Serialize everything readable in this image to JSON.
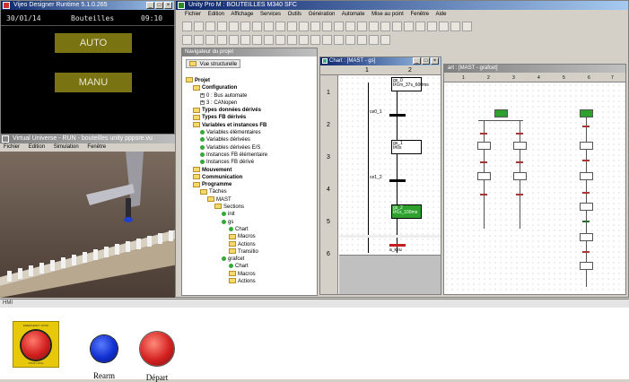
{
  "vijeo": {
    "title": "Vijeo Designer Runtime 5.1.0.265",
    "date": "30/01/14",
    "screen_name": "Bouteilles",
    "time": "09:10",
    "auto_button": "AUTO",
    "manu_button": "MANU"
  },
  "unity": {
    "title": "Unity Pro M : BOUTEILLES M340 SFC",
    "menu": [
      "Fichier",
      "Edition",
      "Affichage",
      "Services",
      "Outils",
      "Génération",
      "Automate",
      "Mise au point",
      "Fenêtre",
      "Aide"
    ]
  },
  "desktop_fragments": [
    "Ad",
    "Do"
  ],
  "navigator": {
    "title": "Navigateur du projet",
    "view_label": "Vue structurelle",
    "tree": [
      {
        "label": "Projet",
        "indent": 0,
        "bold": true,
        "kind": "fold"
      },
      {
        "label": "Configuration",
        "indent": 1,
        "bold": true,
        "kind": "fold"
      },
      {
        "label": "0 : Bus automate",
        "indent": 2,
        "bold": false,
        "kind": "plus"
      },
      {
        "label": "3 : CANopen",
        "indent": 2,
        "bold": false,
        "kind": "plus"
      },
      {
        "label": "Types données dérivés",
        "indent": 1,
        "bold": true,
        "kind": "fold"
      },
      {
        "label": "Types FB dérivés",
        "indent": 1,
        "bold": true,
        "kind": "fold"
      },
      {
        "label": "Variables et instances FB",
        "indent": 1,
        "bold": true,
        "kind": "fold"
      },
      {
        "label": "Variables élémentaires",
        "indent": 2,
        "bold": false,
        "kind": "leaf"
      },
      {
        "label": "Variables dérivées",
        "indent": 2,
        "bold": false,
        "kind": "leaf"
      },
      {
        "label": "Variables dérivées E/S",
        "indent": 2,
        "bold": false,
        "kind": "leaf"
      },
      {
        "label": "Instances FB élémentaire",
        "indent": 2,
        "bold": false,
        "kind": "leaf"
      },
      {
        "label": "Instances FB dérivé",
        "indent": 2,
        "bold": false,
        "kind": "leaf"
      },
      {
        "label": "Mouvement",
        "indent": 1,
        "bold": true,
        "kind": "fold"
      },
      {
        "label": "Communication",
        "indent": 1,
        "bold": true,
        "kind": "fold"
      },
      {
        "label": "Programme",
        "indent": 1,
        "bold": true,
        "kind": "fold"
      },
      {
        "label": "Tâches",
        "indent": 2,
        "bold": false,
        "kind": "fold"
      },
      {
        "label": "MAST",
        "indent": 3,
        "bold": false,
        "kind": "fold"
      },
      {
        "label": "Sections",
        "indent": 4,
        "bold": false,
        "kind": "fold"
      },
      {
        "label": "init",
        "indent": 5,
        "bold": false,
        "kind": "leaf"
      },
      {
        "label": "gs",
        "indent": 5,
        "bold": false,
        "kind": "leaf"
      },
      {
        "label": "Chart",
        "indent": 6,
        "bold": false,
        "kind": "leaf"
      },
      {
        "label": "Macros",
        "indent": 6,
        "bold": false,
        "kind": "fold"
      },
      {
        "label": "Actions",
        "indent": 6,
        "bold": false,
        "kind": "fold"
      },
      {
        "label": "Transitio",
        "indent": 6,
        "bold": false,
        "kind": "fold"
      },
      {
        "label": "grafcet",
        "indent": 5,
        "bold": false,
        "kind": "leaf"
      },
      {
        "label": "Chart",
        "indent": 6,
        "bold": false,
        "kind": "leaf"
      },
      {
        "label": "Macros",
        "indent": 6,
        "bold": false,
        "kind": "fold"
      },
      {
        "label": "Actions",
        "indent": 6,
        "bold": false,
        "kind": "fold"
      }
    ]
  },
  "chart_gs": {
    "title": "Chart : [MAST - gs]",
    "columns": [
      "1",
      "2"
    ],
    "rows": [
      "1",
      "2",
      "3",
      "4",
      "5",
      "6"
    ],
    "steps": [
      {
        "name": "gs_0",
        "detail": "t#1m_37s_600ms",
        "active": false
      },
      {
        "name": "gs_1",
        "detail": "t#0s",
        "active": false
      },
      {
        "name": "gs_2",
        "detail": "t#1s_100ms",
        "active": true
      }
    ],
    "transitions": [
      "ce0_1",
      "ce1_2",
      "a_keu"
    ]
  },
  "chart_grafcet": {
    "title": "art : [MAST - grafcet]",
    "columns": [
      "1",
      "2",
      "3",
      "4",
      "5",
      "6",
      "7"
    ]
  },
  "virtual_universe": {
    "title": "Virtual Universe - RUN - bouteilles unity pppsre.vu",
    "menu": [
      "Fichier",
      "Edition",
      "Simulation",
      "Fenêtre"
    ]
  },
  "hmi": {
    "title": "HMI",
    "emergency_label": "EMERGENCY STOP",
    "stop_label": "STOP LOCK",
    "reset_label": "Rearm",
    "start_label": "Départ",
    "colors": {
      "red": "#d32020",
      "blue": "#1030d0",
      "panel": "#e7c80a"
    }
  }
}
